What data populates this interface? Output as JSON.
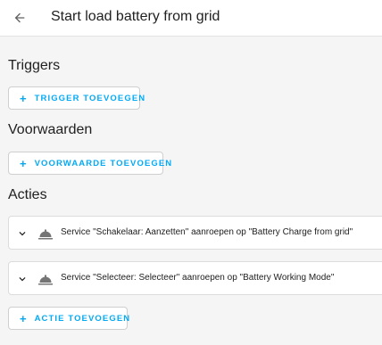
{
  "header": {
    "title": "Start load battery from grid",
    "back_icon": "arrow-left-icon"
  },
  "sections": {
    "triggers": {
      "heading": "Triggers",
      "add_label": "TRIGGER TOEVOEGEN"
    },
    "conditions": {
      "heading": "Voorwaarden",
      "add_label": "VOORWAARDE TOEVOEGEN"
    },
    "actions": {
      "heading": "Acties",
      "items": [
        {
          "description": "Service \"Schakelaar: Aanzetten\" aanroepen op \"Battery Charge from grid\"",
          "icon": "service-icon"
        },
        {
          "description": "Service \"Selecteer: Selecteer\" aanroepen op \"Battery Working Mode\"",
          "icon": "service-icon"
        }
      ],
      "add_label": "ACTIE TOEVOEGEN"
    }
  },
  "colors": {
    "accent": "#03a9f4",
    "background": "#f5f5f5",
    "card": "#ffffff",
    "text": "#212121"
  },
  "plus_symbol": "+"
}
